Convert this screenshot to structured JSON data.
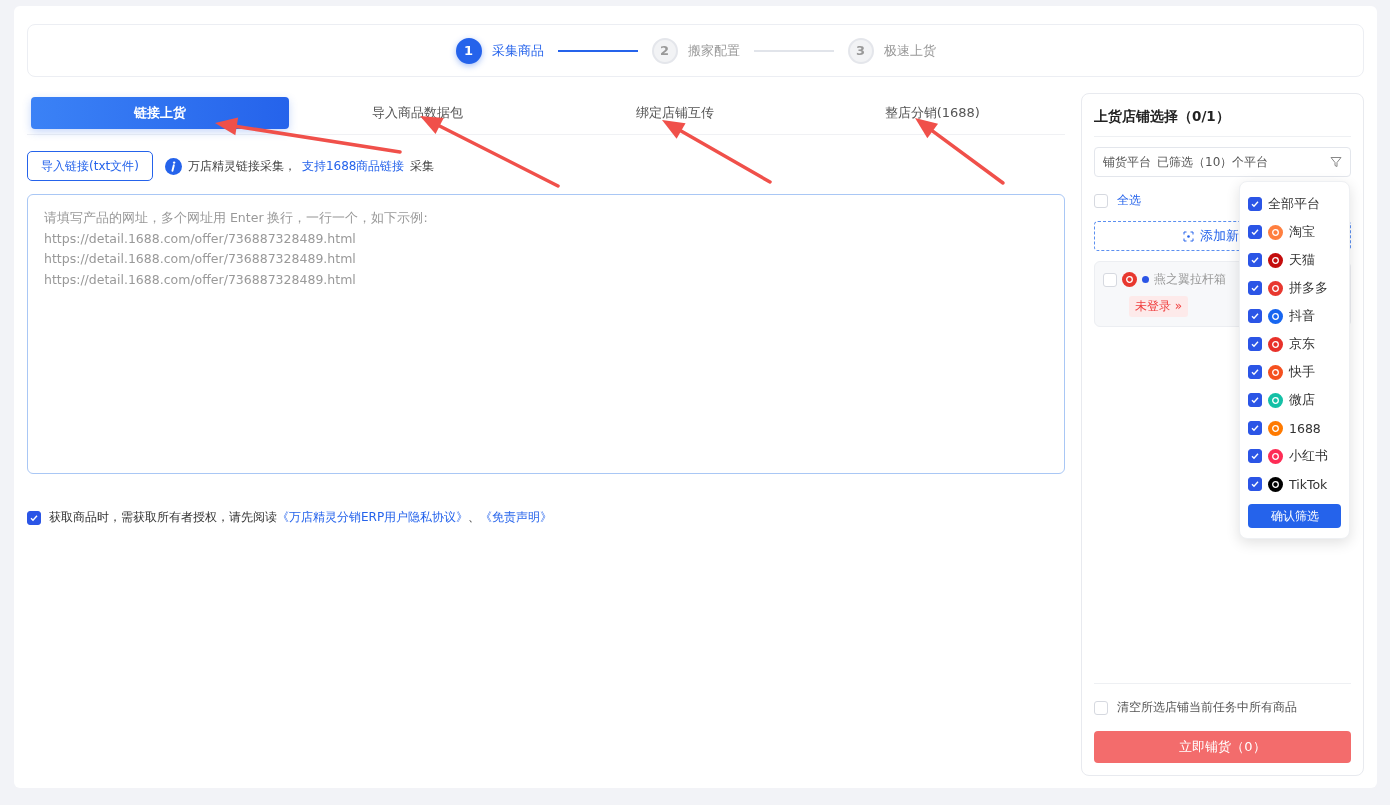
{
  "steps": [
    {
      "number": "1",
      "label": "采集商品",
      "active": true
    },
    {
      "number": "2",
      "label": "搬家配置",
      "active": false
    },
    {
      "number": "3",
      "label": "极速上货",
      "active": false
    }
  ],
  "tabs": [
    {
      "label": "链接上货",
      "selected": true
    },
    {
      "label": "导入商品数据包",
      "selected": false
    },
    {
      "label": "绑定店铺互传",
      "selected": false
    },
    {
      "label": "整店分销(1688)",
      "selected": false
    }
  ],
  "import_button": "导入链接(txt文件)",
  "info": {
    "text": "万店精灵链接采集，",
    "link": "支持1688商品链接",
    "suffix": "采集"
  },
  "url_input": {
    "placeholder": "请填写产品的网址，多个网址用 Enter 换行，一行一个，如下示例:\nhttps://detail.1688.com/offer/736887328489.html\nhttps://detail.1688.com/offer/736887328489.html\nhttps://detail.1688.com/offer/736887328489.html"
  },
  "agreement": {
    "checked": true,
    "text": "获取商品时，需获取所有者授权，请先阅读",
    "link1": "《万店精灵分销ERP用户隐私协议》",
    "separator": "、",
    "link2": "《免责声明》"
  },
  "store_panel": {
    "title": "上货店铺选择（0/1）",
    "filter_label": "铺货平台",
    "filter_value": "已筛选（10）个平台",
    "select_all": {
      "label": "全选",
      "checked": false
    },
    "add_store": "添加新",
    "stores": [
      {
        "name": "燕之翼拉杆箱",
        "checked": false,
        "status": "未登录 »",
        "color": "#e8382f"
      }
    ],
    "clear": {
      "label": "清空所选店铺当前任务中所有商品",
      "checked": false
    },
    "submit": "立即铺货（0）"
  },
  "platform_dropdown": {
    "items": [
      {
        "label": "全部平台",
        "checked": true
      },
      {
        "label": "淘宝",
        "checked": true,
        "color": "#ff7f3f"
      },
      {
        "label": "天猫",
        "checked": true,
        "color": "#c40d0d"
      },
      {
        "label": "拼多多",
        "checked": true,
        "color": "#e8382f"
      },
      {
        "label": "抖音",
        "checked": true,
        "color": "#1766f0"
      },
      {
        "label": "京东",
        "checked": true,
        "color": "#e8312a"
      },
      {
        "label": "快手",
        "checked": true,
        "color": "#f5501f"
      },
      {
        "label": "微店",
        "checked": true,
        "color": "#14c0a6"
      },
      {
        "label": "1688",
        "checked": true,
        "color": "#ff7a00"
      },
      {
        "label": "小红书",
        "checked": true,
        "color": "#fe2c55"
      },
      {
        "label": "TikTok",
        "checked": true,
        "color": "#000000"
      }
    ],
    "confirm": "确认筛选"
  }
}
